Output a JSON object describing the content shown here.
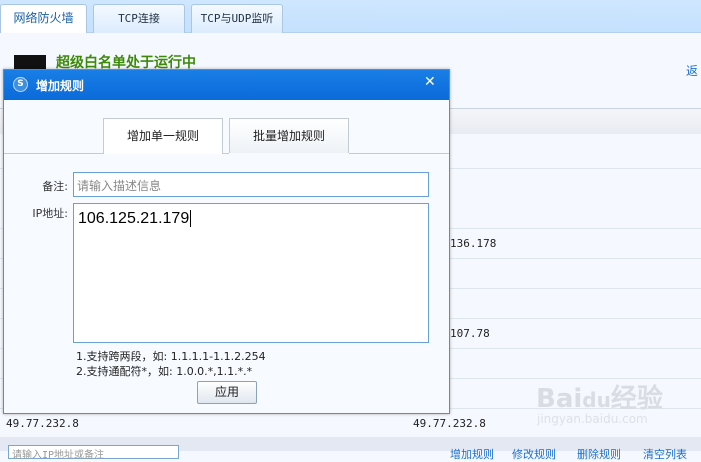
{
  "top_tabs": [
    "网络防火墙",
    "TCP连接",
    "TCP与UDP监听"
  ],
  "status_text": "超级白名单处于运行中",
  "back_link": "返",
  "list_cells": {
    "r1": "136.178",
    "r2": "107.78",
    "r3a": "49.77.232.8",
    "r3b": "49.77.232.8"
  },
  "bottom": {
    "search_placeholder": "请输入IP地址或备注",
    "links": [
      "增加规则",
      "修改规则",
      "删除规则",
      "清空列表"
    ]
  },
  "dialog": {
    "title": "增加规则",
    "close": "✕",
    "tabs": [
      "增加单一规则",
      "批量增加规则"
    ],
    "remark_label": "备注:",
    "remark_placeholder": "请输入描述信息",
    "ip_label": "IP地址:",
    "ip_value": "106.125.21.179",
    "hints": [
      "1.支持跨两段，如: 1.1.1.1-1.1.2.254",
      "2.支持通配符*，如: 1.0.0.*,1.1.*.*"
    ],
    "apply": "应用"
  },
  "watermark": {
    "brand": "Baidu经验",
    "url": "jingyan.baidu.com"
  }
}
